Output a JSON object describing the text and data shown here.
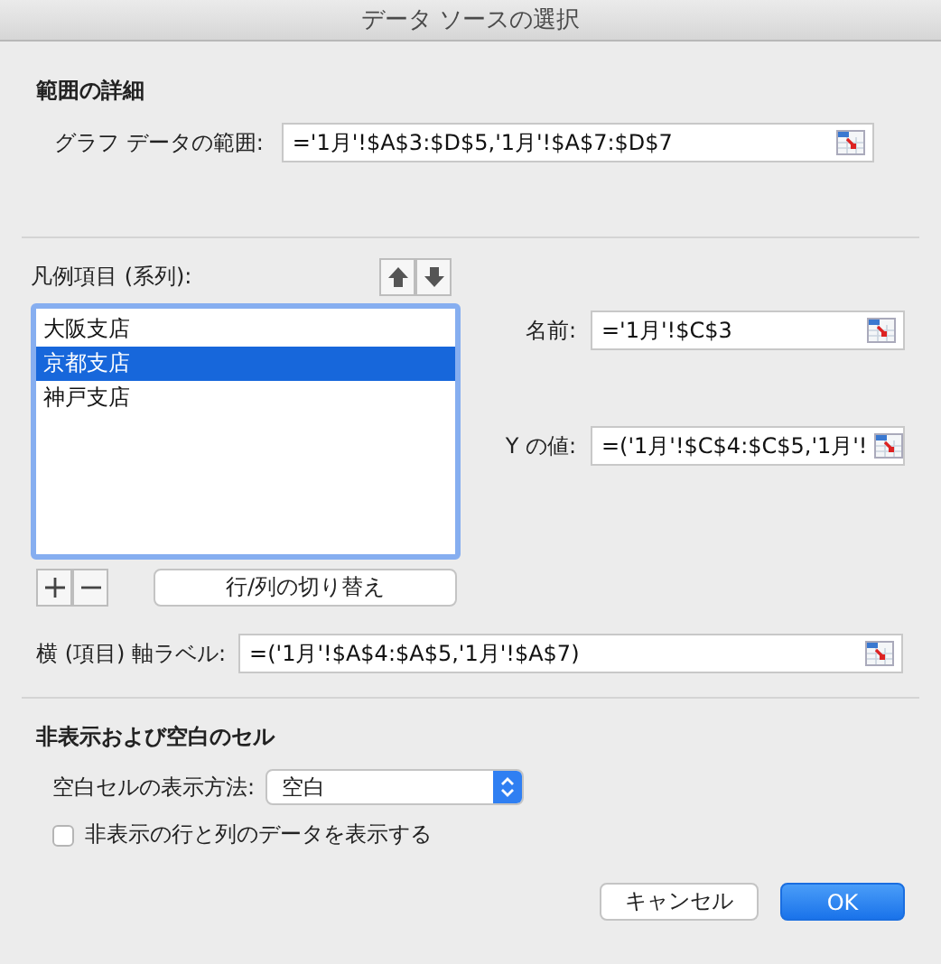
{
  "window": {
    "title": "データ ソースの選択"
  },
  "range_details": {
    "heading": "範囲の詳細",
    "chart_data_range": {
      "label": "グラフ データの範囲:",
      "value": "='1月'!$A$3:$D$5,'1月'!$A$7:$D$7"
    }
  },
  "legend_entries": {
    "label": "凡例項目 (系列):",
    "series": [
      {
        "name": "大阪支店",
        "selected": false
      },
      {
        "name": "京都支店",
        "selected": true
      },
      {
        "name": "神戸支店",
        "selected": false
      }
    ],
    "name_field": {
      "label": "名前:",
      "value": "='1月'!$C$3"
    },
    "y_values_field": {
      "label": "Y の値:",
      "value": "=('1月'!$C$4:$C$5,'1月'!"
    },
    "switch_button": "行/列の切り替え"
  },
  "axis_labels": {
    "label": "横 (項目) 軸ラベル:",
    "value": "=('1月'!$A$4:$A$5,'1月'!$A$7)"
  },
  "hidden_empty_cells": {
    "heading": "非表示および空白のセル",
    "empty_cells_as": {
      "label": "空白セルの表示方法:",
      "value": "空白"
    },
    "show_hidden": {
      "label": "非表示の行と列のデータを表示する",
      "checked": false
    }
  },
  "buttons": [
    {
      "label": "キャンセル",
      "kind": "secondary"
    },
    {
      "label": "OK",
      "kind": "default"
    }
  ]
}
